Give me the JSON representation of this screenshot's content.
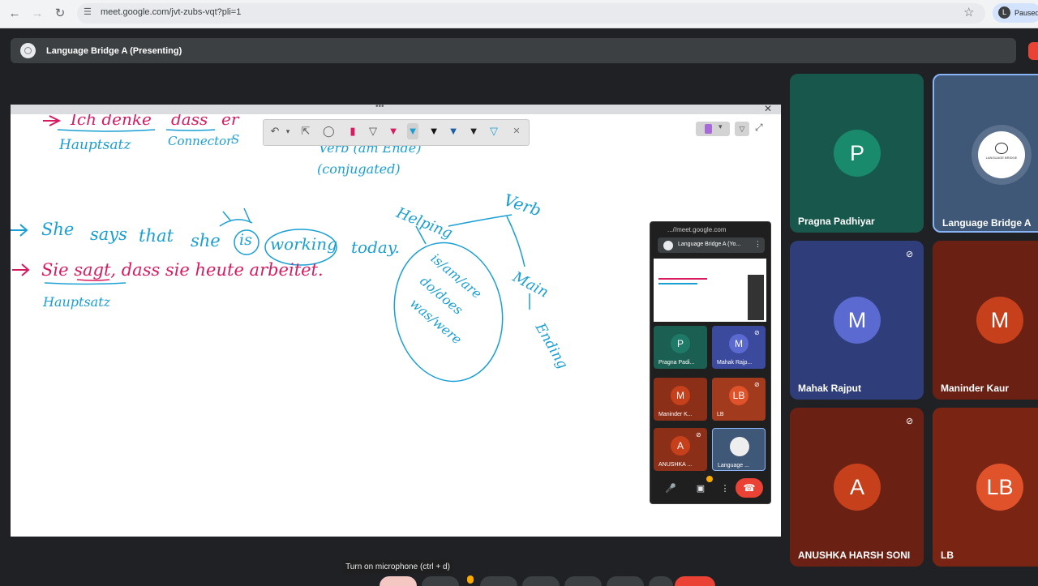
{
  "browser": {
    "url": "meet.google.com/jvt-zubs-vqt?pli=1",
    "profile_initial": "L",
    "profile_status": "Paused"
  },
  "meet": {
    "presenting_title": "Language Bridge A (Presenting)",
    "tooltip": "Turn on microphone (ctrl + d)"
  },
  "whiteboard": {
    "line1": [
      "Ich denke",
      "dass",
      "er"
    ],
    "line1_labels": [
      "Hauptsatz",
      "Connector",
      "S"
    ],
    "verb_note": [
      "Verb (am Ende)",
      "(conjugated)"
    ],
    "line2": [
      "She",
      "says",
      "that",
      "she",
      "is",
      "working",
      "today."
    ],
    "line3": "Sie sagt, dass sie heute arbeitet.",
    "line3_label": "Hauptsatz",
    "diagram": {
      "root": "Verb",
      "helping": "Helping",
      "helping_list": [
        "is/am/are",
        "do/does",
        "was/were"
      ],
      "main": "Main",
      "main_sub": "Ending"
    }
  },
  "mini_window": {
    "url": "...//meet.google.com",
    "title": "Language Bridge A (Yo...",
    "tiles": [
      {
        "initial": "P",
        "name": "Pragna Padi...",
        "color": "#1e7a66",
        "tile": "#1a5f52"
      },
      {
        "initial": "M",
        "name": "Mahak Rajp...",
        "color": "#5b6ad0",
        "tile": "#3b4a9c"
      },
      {
        "initial": "M",
        "name": "Maninder K...",
        "color": "#c6401c",
        "tile": "#8c2f18"
      },
      {
        "initial": "LB",
        "name": "LB",
        "color": "#e0522a",
        "tile": "#a23a1d"
      },
      {
        "initial": "A",
        "name": "ANUSHKA ...",
        "color": "#c6401c",
        "tile": "#8c2f18"
      },
      {
        "initial": "",
        "name": "Language ...",
        "color": "#eee",
        "tile": "#3f5878"
      }
    ]
  },
  "participants": [
    {
      "initial": "P",
      "name": "Pragna Padhiyar",
      "tile": "#17574c",
      "avatar": "#1a8a6c",
      "muted": false
    },
    {
      "initial": "",
      "name": "Language Bridge A",
      "tile": "#3f5878",
      "avatar": "#ffffff",
      "muted": false,
      "logo_text": "LANGUAGE BRIDGE"
    },
    {
      "initial": "M",
      "name": "Mahak Rajput",
      "tile": "#2f3e7a",
      "avatar": "#5b6ad0",
      "muted": true
    },
    {
      "initial": "M",
      "name": "Maninder Kaur",
      "tile": "#6b2014",
      "avatar": "#c6401c",
      "muted": false
    },
    {
      "initial": "A",
      "name": "ANUSHKA HARSH SONI",
      "tile": "#6b2014",
      "avatar": "#c6401c",
      "muted": true
    },
    {
      "initial": "LB",
      "name": "LB",
      "tile": "#7a2414",
      "avatar": "#e0522a",
      "muted": false
    }
  ],
  "icons": [
    "back-icon",
    "forward-icon",
    "reload-icon",
    "tune-icon",
    "star-icon",
    "mic-icon",
    "camera-icon",
    "more-icon",
    "end-call-icon",
    "mic-off-icon"
  ]
}
